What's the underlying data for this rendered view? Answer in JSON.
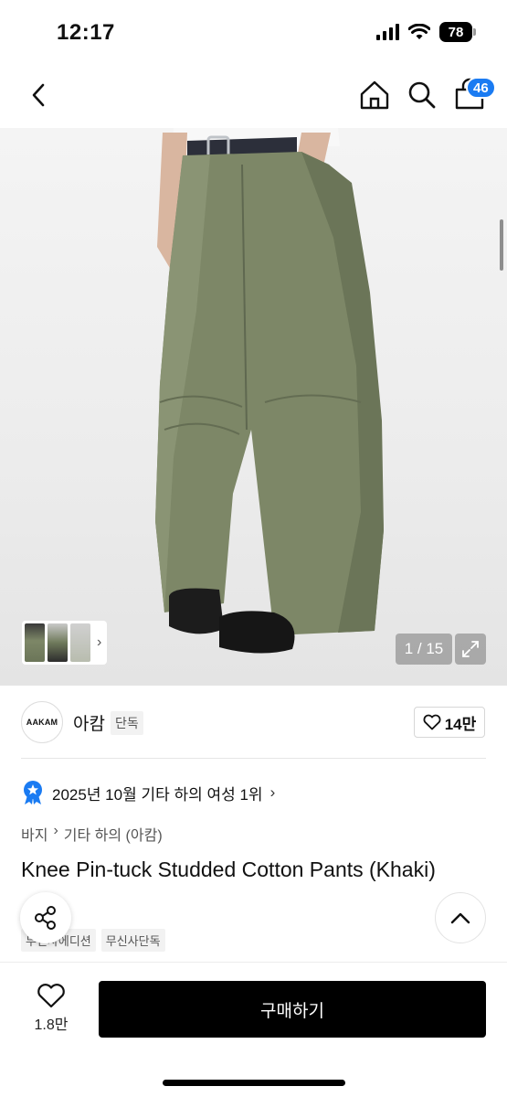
{
  "status_bar": {
    "time": "12:17",
    "battery": "78"
  },
  "nav": {
    "cart_count": "46"
  },
  "gallery": {
    "counter": "1 / 15"
  },
  "brand": {
    "logo_text": "AAKAM",
    "name": "아캄",
    "tag": "단독",
    "likes": "14만"
  },
  "ranking": {
    "text": "2025년 10월 기타 하의 여성 1위"
  },
  "breadcrumb": {
    "category": "바지",
    "subcategory": "기타 하의 (아캄)"
  },
  "product": {
    "title": "Knee Pin-tuck Studded Cotton Pants (Khaki)",
    "tags": [
      "무신사에디션",
      "무신사단독"
    ]
  },
  "bottom": {
    "wish_count": "1.8만",
    "buy_label": "구매하기"
  },
  "colors": {
    "accent": "#1a7bf2",
    "khaki": "#7d8767",
    "buy": "#000000"
  },
  "icons": [
    "back-icon",
    "home-icon",
    "search-icon",
    "cart-icon",
    "expand-icon",
    "heart-icon",
    "share-icon",
    "chevron-up-icon",
    "rank-badge-icon"
  ]
}
